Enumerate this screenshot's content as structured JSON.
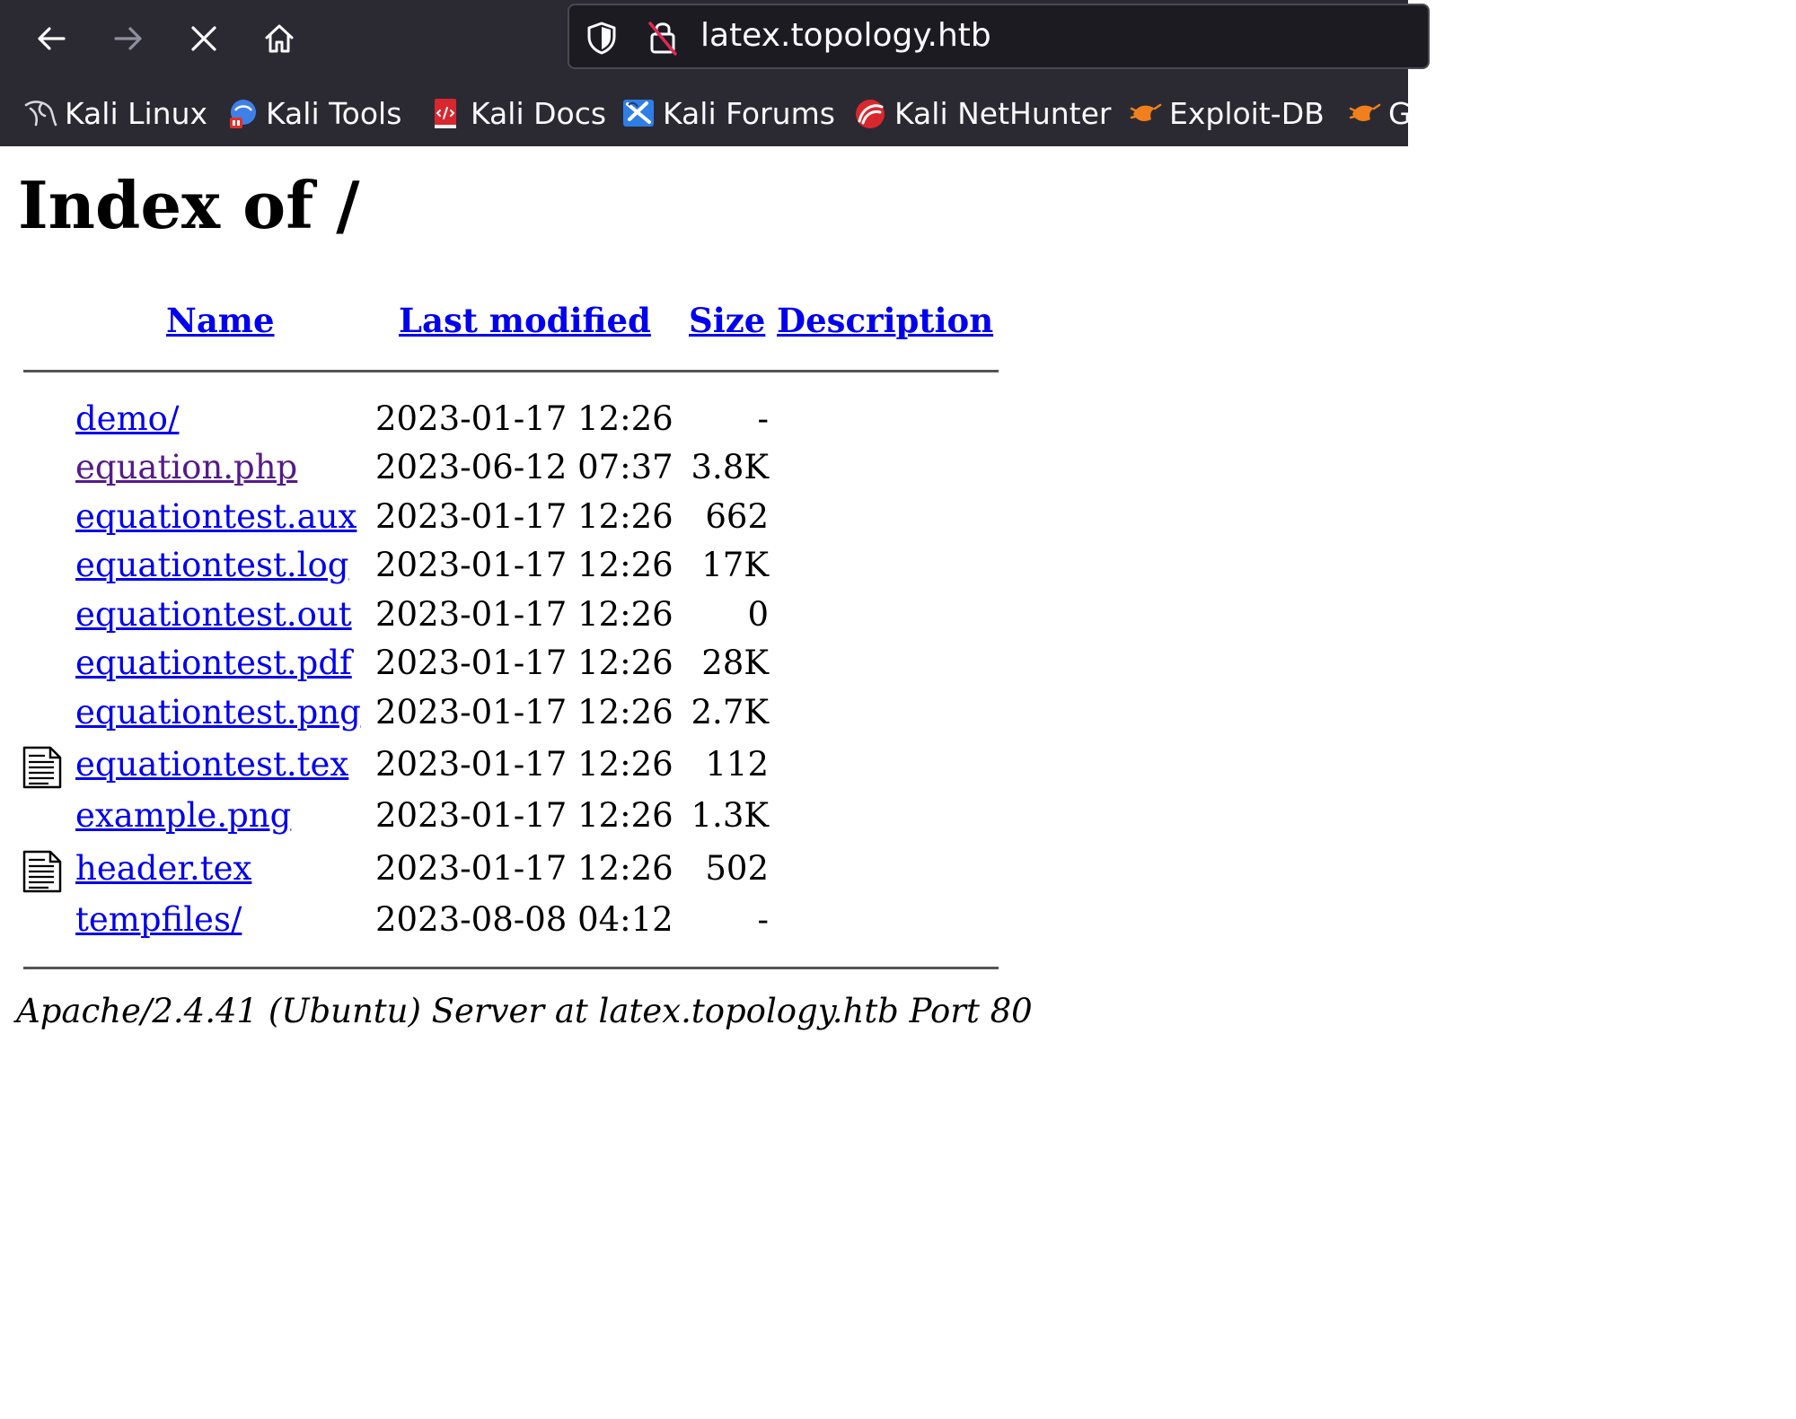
{
  "browser": {
    "url": "latex.topology.htb",
    "bookmarks": [
      {
        "label": "Kali Linux",
        "icon": "kali-dragon-icon"
      },
      {
        "label": "Kali Tools",
        "icon": "kali-tools-icon"
      },
      {
        "label": "Kali Docs",
        "icon": "kali-docs-icon"
      },
      {
        "label": "Kali Forums",
        "icon": "kali-forums-icon"
      },
      {
        "label": "Kali NetHunter",
        "icon": "kali-nethunter-icon"
      },
      {
        "label": "Exploit-DB",
        "icon": "exploit-db-icon"
      },
      {
        "label": "G",
        "icon": "exploit-db-icon"
      }
    ]
  },
  "page": {
    "title": "Index of /",
    "columns": {
      "name": "Name",
      "last_modified": "Last modified",
      "size": "Size",
      "description": "Description"
    },
    "files": [
      {
        "name": "demo/",
        "date": "2023-01-17 12:26",
        "size": "-",
        "icon": "",
        "visited": false
      },
      {
        "name": "equation.php",
        "date": "2023-06-12 07:37",
        "size": "3.8K",
        "icon": "",
        "visited": true
      },
      {
        "name": "equationtest.aux",
        "date": "2023-01-17 12:26",
        "size": "662",
        "icon": "",
        "visited": false
      },
      {
        "name": "equationtest.log",
        "date": "2023-01-17 12:26",
        "size": "17K",
        "icon": "",
        "visited": false
      },
      {
        "name": "equationtest.out",
        "date": "2023-01-17 12:26",
        "size": "0",
        "icon": "",
        "visited": false
      },
      {
        "name": "equationtest.pdf",
        "date": "2023-01-17 12:26",
        "size": "28K",
        "icon": "",
        "visited": false
      },
      {
        "name": "equationtest.png",
        "date": "2023-01-17 12:26",
        "size": "2.7K",
        "icon": "",
        "visited": false
      },
      {
        "name": "equationtest.tex",
        "date": "2023-01-17 12:26",
        "size": "112",
        "icon": "text-file-icon",
        "visited": false
      },
      {
        "name": "example.png",
        "date": "2023-01-17 12:26",
        "size": "1.3K",
        "icon": "",
        "visited": false
      },
      {
        "name": "header.tex",
        "date": "2023-01-17 12:26",
        "size": "502",
        "icon": "text-file-icon",
        "visited": false
      },
      {
        "name": "tempfiles/",
        "date": "2023-08-08 04:12",
        "size": "-",
        "icon": "",
        "visited": false
      }
    ],
    "server_signature": "Apache/2.4.41 (Ubuntu) Server at latex.topology.htb Port 80"
  },
  "colors": {
    "chrome_bg": "#2b2a33",
    "link": "#0000ee",
    "visited_link": "#551a8b"
  }
}
